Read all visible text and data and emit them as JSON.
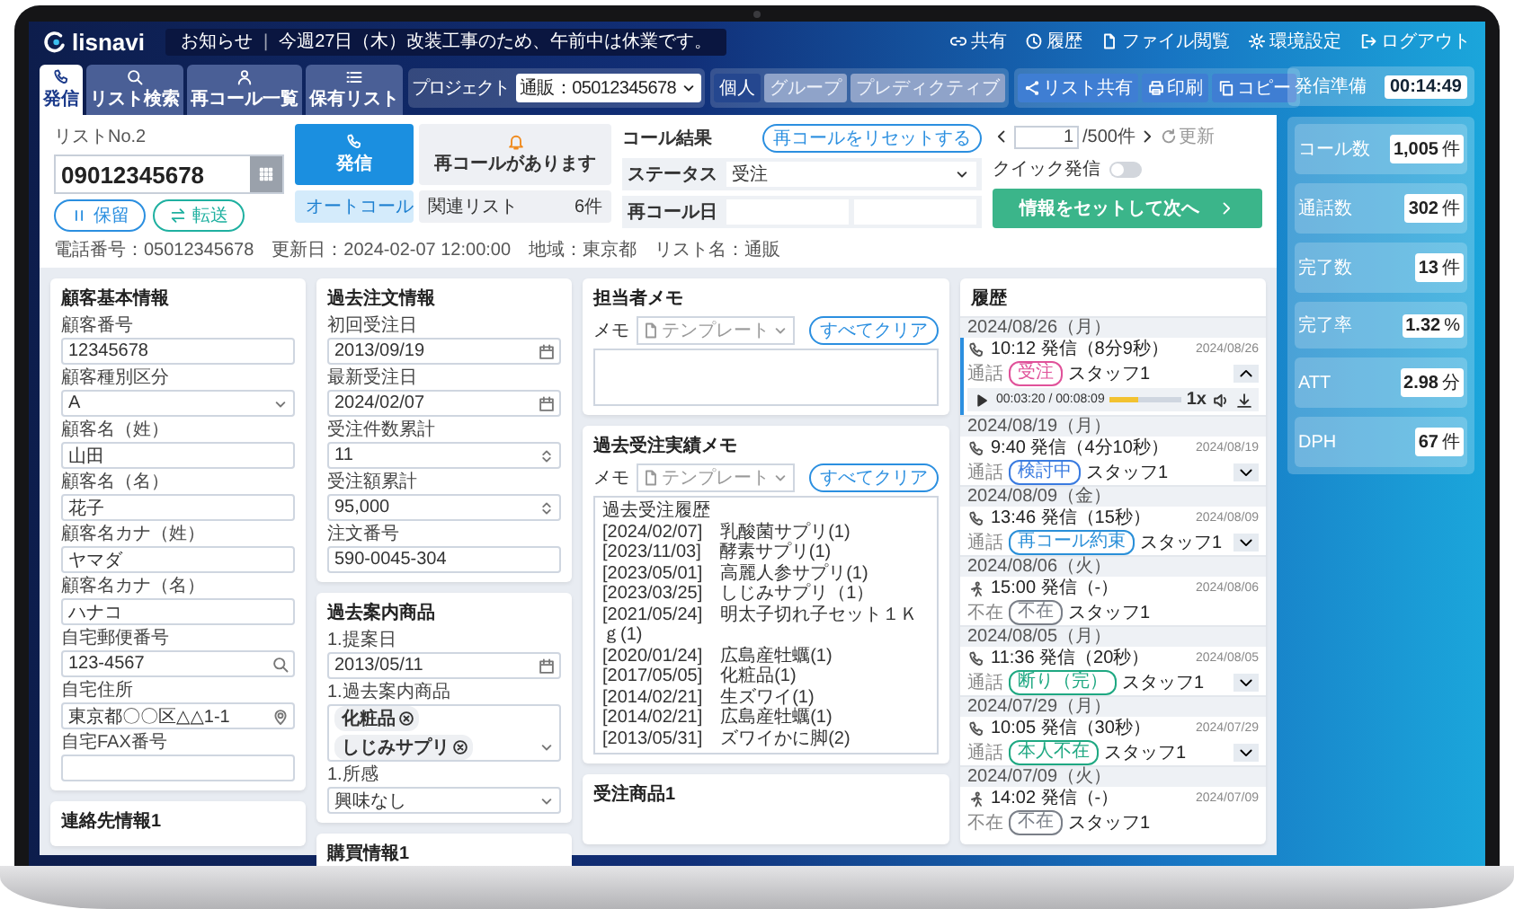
{
  "header": {
    "logo": "lisnavi",
    "notice_label": "お知らせ",
    "notice_separator": "|",
    "notice": "今週27日（木）改装工事のため、午前中は休業です。",
    "links": [
      {
        "label": "共有"
      },
      {
        "label": "履歴"
      },
      {
        "label": "ファイル閲覧"
      },
      {
        "label": "環境設定"
      },
      {
        "label": "ログアウト"
      }
    ]
  },
  "nav_tabs": [
    {
      "label": "発信",
      "selected": true
    },
    {
      "label": "リスト検索",
      "selected": false
    },
    {
      "label": "再コール一覧",
      "selected": false
    },
    {
      "label": "保有リスト",
      "selected": false
    }
  ],
  "project": {
    "label": "プロジェクト",
    "value": "通販：05012345678"
  },
  "modes": [
    {
      "label": "個人",
      "selected": true
    },
    {
      "label": "グループ",
      "selected": false
    },
    {
      "label": "プレディクティブ",
      "selected": false
    }
  ],
  "tools": [
    {
      "label": "リスト共有"
    },
    {
      "label": "印刷"
    },
    {
      "label": "コピー"
    }
  ],
  "dial_status": {
    "label": "発信準備",
    "timer": "00:14:49"
  },
  "stats": [
    {
      "label": "コール数",
      "value": "1,005",
      "unit": "件"
    },
    {
      "label": "通話数",
      "value": "302",
      "unit": "件"
    },
    {
      "label": "完了数",
      "value": "13",
      "unit": "件"
    },
    {
      "label": "完了率",
      "value": "1.32",
      "unit": "%"
    },
    {
      "label": "ATT",
      "value": "2.98",
      "unit": "分"
    },
    {
      "label": "DPH",
      "value": "67",
      "unit": "件"
    }
  ],
  "call": {
    "list_no": "リストNo.2",
    "phone": "09012345678",
    "hold": "保留",
    "transfer": "転送",
    "dial": "発信",
    "recall_notice": "再コールがあります",
    "auto_call": "オートコール",
    "related_label": "関連リスト",
    "related_count": "6件",
    "info": "電話番号：05012345678　更新日：2024-02-07 12:00:00　地域：東京都　リスト名：通販"
  },
  "result": {
    "title": "コール結果",
    "reset": "再コールをリセットする",
    "status_label": "ステータス",
    "status": "受注",
    "recall_label": "再コール日"
  },
  "pager": {
    "page": "1",
    "total": "/500件",
    "refresh": "更新"
  },
  "quick_dial": {
    "label": "クイック発信",
    "on": false
  },
  "next_button": "情報をセットして次へ",
  "columns": [
    {
      "panels": [
        {
          "kind": "form",
          "title": "顧客基本情報",
          "fields": [
            {
              "label": "顧客番号",
              "value": "12345678",
              "kind": "text"
            },
            {
              "label": "顧客種別区分",
              "value": "A",
              "kind": "select"
            },
            {
              "label": "顧客名（姓）",
              "value": "山田",
              "kind": "text"
            },
            {
              "label": "顧客名（名）",
              "value": "花子",
              "kind": "text"
            },
            {
              "label": "顧客名カナ（姓）",
              "value": "ヤマダ",
              "kind": "text"
            },
            {
              "label": "顧客名カナ（名）",
              "value": "ハナコ",
              "kind": "text"
            },
            {
              "label": "自宅郵便番号",
              "value": "123-4567",
              "kind": "zip"
            },
            {
              "label": "自宅住所",
              "value": "東京都〇〇区△△1-1",
              "kind": "address"
            },
            {
              "label": "自宅FAX番号",
              "kind": "text"
            }
          ]
        },
        {
          "kind": "stub",
          "title": "連絡先情報1"
        }
      ]
    },
    {
      "panels": [
        {
          "kind": "form",
          "title": "過去注文情報",
          "fields": [
            {
              "label": "初回受注日",
              "value": "2013/09/19",
              "kind": "date"
            },
            {
              "label": "最新受注日",
              "value": "2024/02/07",
              "kind": "date"
            },
            {
              "label": "受注件数累計",
              "value": "11",
              "kind": "number"
            },
            {
              "label": "受注額累計",
              "value": "95,000",
              "kind": "number"
            },
            {
              "label": "注文番号",
              "value": "590-0045-304",
              "kind": "text"
            }
          ]
        },
        {
          "kind": "form",
          "title": "過去案内商品",
          "fields": [
            {
              "label": "1.提案日",
              "value": "2013/05/11",
              "kind": "date"
            },
            {
              "label": "1.過去案内商品",
              "values": [
                "化粧品",
                "しじみサプリ"
              ],
              "kind": "chips"
            },
            {
              "label": "1.所感",
              "value": "興味なし",
              "kind": "select"
            }
          ]
        },
        {
          "kind": "stub",
          "title": "購買情報1"
        }
      ]
    },
    {
      "panels": [
        {
          "kind": "memo",
          "title": "担当者メモ",
          "memo_label": "メモ",
          "template": "テンプレート",
          "clear": "すべてクリア"
        },
        {
          "kind": "memo",
          "title": "過去受注実績メモ",
          "memo_label": "メモ",
          "template": "テンプレート",
          "clear": "すべてクリア",
          "log_title": "過去受注履歴",
          "log": [
            "[2024/02/07]　乳酸菌サプリ(1)",
            "[2023/11/03]　酵素サプリ(1)",
            "[2023/05/01]　高麗人参サプリ(1)",
            "[2023/03/25]　しじみサプリ（1）",
            "[2021/05/24]　明太子切れ子セット１Ｋｇ(1)",
            "[2020/01/24]　広島産牡蠣(1)",
            "[2017/05/05]　化粧品(1)",
            "[2014/02/21]　生ズワイ(1)",
            "[2014/02/21]　広島産牡蠣(1)",
            "[2013/05/31]　ズワイかに脚(2)"
          ]
        },
        {
          "kind": "stub",
          "title": "受注商品1"
        }
      ]
    },
    {
      "panels": [
        {
          "kind": "history",
          "title": "履歴",
          "entries": [
            {
              "date": "2024/08/26（月）",
              "kind": "call",
              "time": "10:12 発信（8分9秒）",
              "sub": "通話",
              "tag": "受注",
              "color": "#e0529a",
              "staff": "スタッフ1",
              "stamp": "2024/08/26",
              "expanded": true,
              "player": {
                "time": "00:03:20 / 00:08:09",
                "level": 0.4,
                "speed": "1x"
              }
            },
            {
              "date": "2024/08/19（月）",
              "kind": "call",
              "time": "9:40 発信（4分10秒）",
              "sub": "通話",
              "tag": "検討中",
              "color": "#3a7be0",
              "staff": "スタッフ1",
              "stamp": "2024/08/19",
              "expanded": false
            },
            {
              "date": "2024/08/09（金）",
              "kind": "call",
              "time": "13:46 発信（15秒）",
              "sub": "通話",
              "tag": "再コール約束",
              "color": "#2a8fd8",
              "staff": "スタッフ1",
              "stamp": "2024/08/09",
              "expanded": false
            },
            {
              "date": "2024/08/06（火）",
              "kind": "absent",
              "time": "15:00 発信（-）",
              "sub": "不在",
              "tag": "不在",
              "color": "#7a7f88",
              "staff": "スタッフ1",
              "stamp": "2024/08/06",
              "expanded": false
            },
            {
              "date": "2024/08/05（月）",
              "kind": "call",
              "time": "11:36 発信（20秒）",
              "sub": "通話",
              "tag": "断り（完）",
              "color": "#1fa882",
              "staff": "スタッフ1",
              "stamp": "2024/08/05",
              "expanded": false
            },
            {
              "date": "2024/07/29（月）",
              "kind": "call",
              "time": "10:05 発信（30秒）",
              "sub": "通話",
              "tag": "本人不在",
              "color": "#1fa882",
              "staff": "スタッフ1",
              "stamp": "2024/07/29",
              "expanded": false
            },
            {
              "date": "2024/07/09（火）",
              "kind": "absent",
              "time": "14:02 発信（-）",
              "sub": "不在",
              "tag": "不在",
              "color": "#7a7f88",
              "staff": "スタッフ1",
              "stamp": "2024/07/09",
              "expanded": false
            }
          ]
        }
      ]
    }
  ]
}
